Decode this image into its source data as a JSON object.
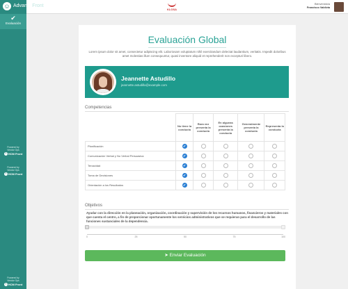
{
  "header": {
    "brand_main": "Advance",
    "brand_accent": "Front",
    "company_logo_text": "KLOSA",
    "welcome_label": "Bienvenido/a",
    "user_name": "Francisco Valdivia"
  },
  "sidebar": {
    "active_item": "Evaluación",
    "powered_by": [
      "Powered by",
      "Vendor Ops"
    ],
    "powered_brand": "HCM Front"
  },
  "page": {
    "title": "Evaluación Global",
    "intro": "Lorem ipsum dolor sit amet, consectetur adipiscing elit. Laboriosam voluptatum nihil exercitandum delectat laudantium, veritatis. Impedit doloribus amet molestias illum consequuntur, quasi inventore aliquid et reprehenderit non excepturi libero."
  },
  "employee": {
    "name": "Jeannette Astudillo",
    "email": "jeannette.astudillo@example.com"
  },
  "competencias": {
    "label": "Competencias",
    "columns": [
      "No tiene la conducta",
      "Rara vez presenta la conducta",
      "En algunas ocasiones presenta la conducta",
      "Generalmente presenta la conducta",
      "Representa la conducta"
    ],
    "rows": [
      {
        "name": "Planificación",
        "selected": 0
      },
      {
        "name": "Comunicación Verbal y No Verbal Persuasiva",
        "selected": 0
      },
      {
        "name": "Tenacidad",
        "selected": 0
      },
      {
        "name": "Toma de Decisiones",
        "selected": 0
      },
      {
        "name": "Orientación a los Resultados",
        "selected": 0
      }
    ]
  },
  "objetivos": {
    "label": "Objetivos",
    "text": "Ayudar con la dirección en la planeación, organización, coordinación y supervisión de los recursos humanos, financieros y materiales con que cuenta el centro, a fin de proporcionar oportunamente los servicios administrativos que se requieran para el desarrollo de las funciones sustanciales de la dependencia.",
    "slider_value": 0,
    "ticks": [
      "0",
      "25",
      "50",
      "75",
      "100"
    ]
  },
  "submit": {
    "label": "Enviar Evaluación"
  },
  "colors": {
    "accent": "#2a8a80",
    "primary_button": "#5cb85c",
    "radio_selected": "#2a7fd4"
  }
}
